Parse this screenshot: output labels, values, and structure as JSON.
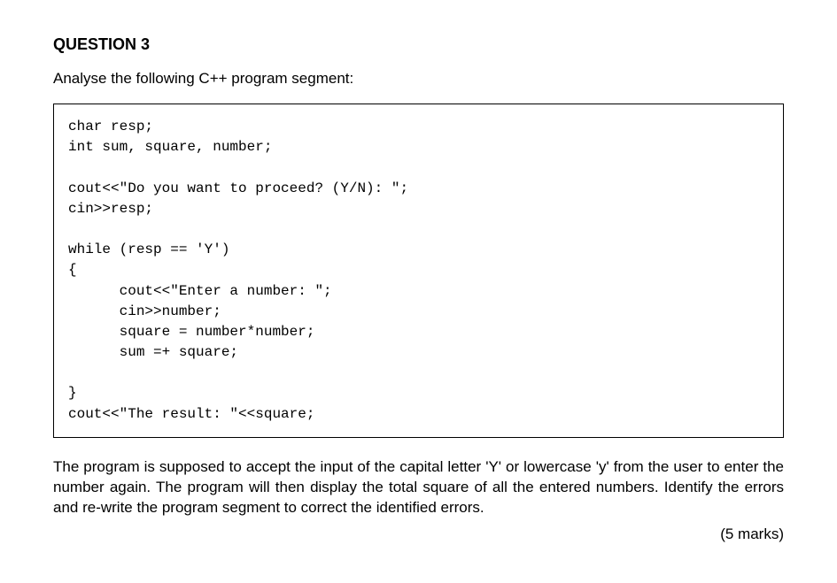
{
  "question": {
    "title": "QUESTION 3",
    "intro": "Analyse the following C++ program segment:",
    "code": "char resp;\nint sum, square, number;\n\ncout<<\"Do you want to proceed? (Y/N): \";\ncin>>resp;\n\nwhile (resp == 'Y')\n{\n      cout<<\"Enter a number: \";\n      cin>>number;\n      square = number*number;\n      sum =+ square;\n\n}\ncout<<\"The result: \"<<square;",
    "body": "The program is supposed to accept the input of the capital letter 'Y' or lowercase 'y' from the user to enter the number again. The program will then display the total square of all the entered numbers. Identify the errors and re-write the program segment to correct the identified errors.",
    "marks": "(5 marks)"
  }
}
